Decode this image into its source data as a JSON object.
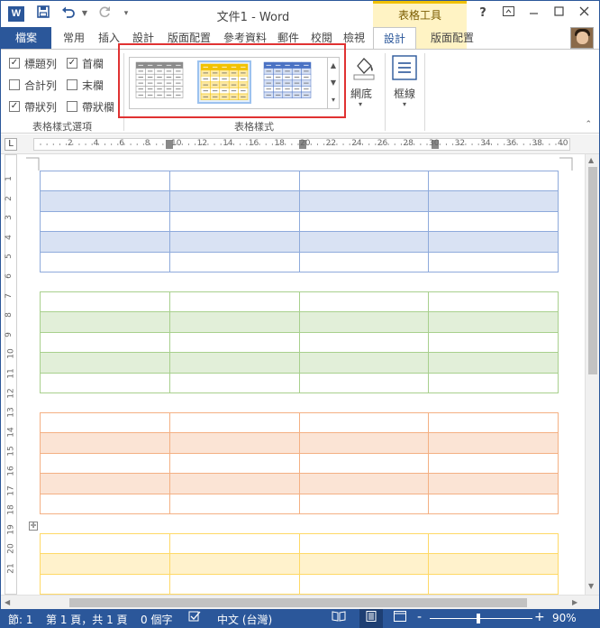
{
  "titlebar": {
    "doc_title": "文件1 - Word",
    "context_title": "表格工具",
    "help": "?",
    "app_icon": "W"
  },
  "tabs": [
    {
      "label": "檔案",
      "name": "tab-file"
    },
    {
      "label": "常用",
      "name": "tab-home"
    },
    {
      "label": "插入",
      "name": "tab-insert"
    },
    {
      "label": "設計",
      "name": "tab-design-doc"
    },
    {
      "label": "版面配置",
      "name": "tab-page-layout"
    },
    {
      "label": "參考資料",
      "name": "tab-references"
    },
    {
      "label": "郵件",
      "name": "tab-mailings"
    },
    {
      "label": "校閱",
      "name": "tab-review"
    },
    {
      "label": "檢視",
      "name": "tab-view"
    },
    {
      "label": "設計",
      "name": "tab-table-design"
    },
    {
      "label": "版面配置",
      "name": "tab-table-layout"
    }
  ],
  "style_options": {
    "items": [
      {
        "label": "標題列",
        "checked": true
      },
      {
        "label": "首欄",
        "checked": true
      },
      {
        "label": "合計列",
        "checked": false
      },
      {
        "label": "末欄",
        "checked": false
      },
      {
        "label": "帶狀列",
        "checked": true
      },
      {
        "label": "帶狀欄",
        "checked": false
      }
    ],
    "group_label": "表格樣式選項"
  },
  "table_styles": {
    "group_label": "表格樣式",
    "thumbs": [
      {
        "color": "#8c8c8c"
      },
      {
        "color": "#f2c200"
      },
      {
        "color": "#4a72c4"
      }
    ]
  },
  "shading": {
    "label": "網底"
  },
  "borders": {
    "label": "框線"
  },
  "ruler": {
    "h_labels": [
      "2",
      "4",
      "6",
      "8",
      "10",
      "12",
      "14",
      "16",
      "18",
      "20",
      "22",
      "24",
      "26",
      "28",
      "30",
      "32",
      "34",
      "36",
      "38",
      "40"
    ],
    "v_labels": [
      "1",
      "2",
      "3",
      "4",
      "5",
      "6",
      "7",
      "8",
      "9",
      "10",
      "11",
      "12",
      "13",
      "14",
      "15",
      "16",
      "17",
      "18",
      "19",
      "20",
      "21"
    ]
  },
  "tables": [
    {
      "border": "#8eaadb",
      "band": "#d9e2f3",
      "rows": 5
    },
    {
      "border": "#a8d08d",
      "band": "#e2efd9",
      "rows": 5
    },
    {
      "border": "#f4b083",
      "band": "#fbe4d5",
      "rows": 5
    },
    {
      "border": "#ffd966",
      "band": "#fff2cc",
      "rows": 4
    }
  ],
  "status": {
    "section": "節: 1",
    "page": "第 1 頁，共 1 頁",
    "words": "0 個字",
    "language": "中文 (台灣)",
    "zoom": "90%",
    "zoom_minus": "-",
    "zoom_plus": "+"
  }
}
